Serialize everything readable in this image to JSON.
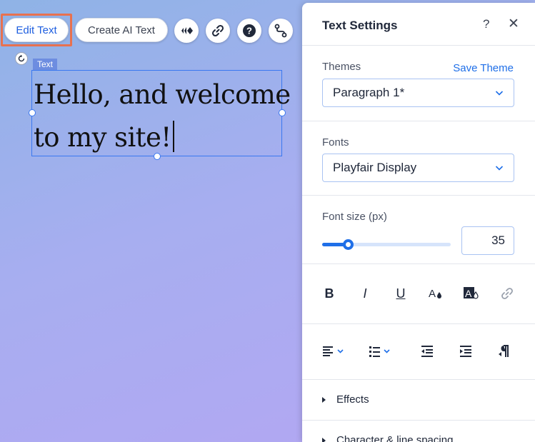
{
  "toolbar": {
    "edit_text_label": "Edit Text",
    "create_ai_text_label": "Create AI Text",
    "icons": [
      "animation-icon",
      "link-icon",
      "help-icon",
      "connect-icon"
    ]
  },
  "canvas": {
    "element_tag": "Text",
    "text_lines": [
      "Hello, and welcome",
      "to my site!"
    ]
  },
  "panel": {
    "title": "Text Settings",
    "help_glyph": "?",
    "close_glyph": "✕",
    "themes": {
      "label": "Themes",
      "save_link": "Save Theme",
      "selected": "Paragraph 1*"
    },
    "fonts": {
      "label": "Fonts",
      "selected": "Playfair Display"
    },
    "font_size": {
      "label": "Font size (px)",
      "value": "35",
      "slider_fraction": 0.2
    },
    "format_tools": {
      "bold": "B",
      "italic": "I",
      "underline": "U",
      "icons": [
        "text-color-icon",
        "highlight-color-icon",
        "link-icon"
      ]
    },
    "align_tools": [
      "align-left-icon",
      "bullet-list-icon",
      "decrease-indent-icon",
      "increase-indent-icon",
      "text-direction-icon"
    ],
    "sections": {
      "effects": "Effects",
      "character_spacing": "Character & line spacing"
    }
  },
  "colors": {
    "accent": "#1f6fe8",
    "highlight": "#e8714f",
    "selection": "#3a78f0"
  }
}
